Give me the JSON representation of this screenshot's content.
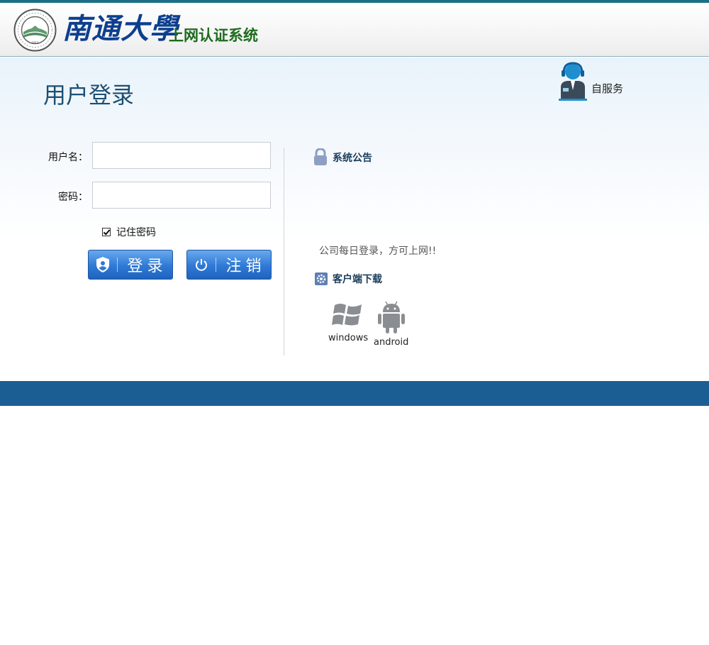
{
  "header": {
    "university_name": "南通大學",
    "system_name": "上网认证系统"
  },
  "login": {
    "title": "用户登录",
    "username_label": "用户名：",
    "username_value": "",
    "password_label": "密码：",
    "password_value": "",
    "remember_label": "记住密码",
    "remember_checked": true,
    "login_button": "登录",
    "logout_button": "注销"
  },
  "self_service": {
    "label": "自服务"
  },
  "announcement": {
    "title": "系统公告",
    "text": "公司每日登录，方可上网!!"
  },
  "downloads": {
    "title": "客户端下载",
    "items": [
      {
        "label": "windows",
        "icon": "windows-icon"
      },
      {
        "label": "android",
        "icon": "android-icon"
      }
    ]
  },
  "colors": {
    "header_accent": "#1a6f86",
    "footer": "#1b5e93",
    "button": "#2f79d6",
    "title": "#1d4f72"
  }
}
